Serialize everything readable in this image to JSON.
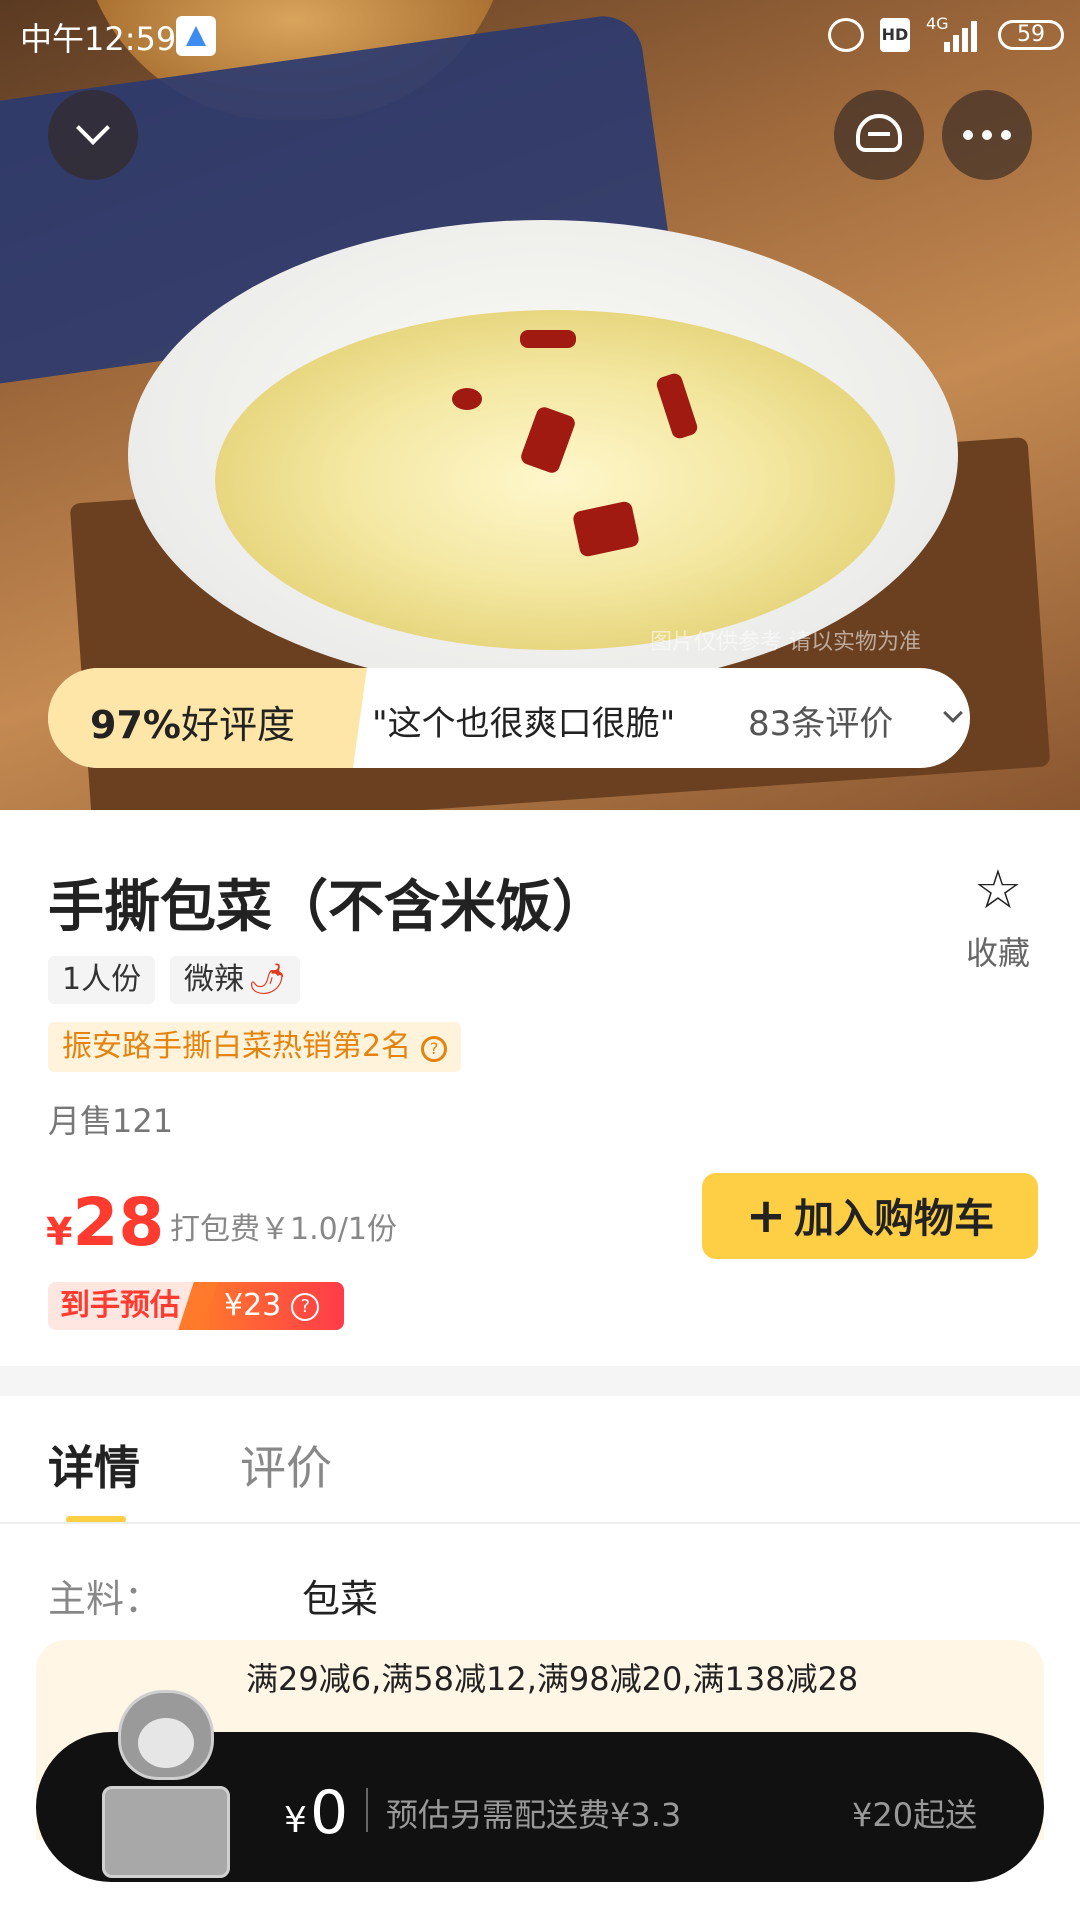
{
  "status_bar": {
    "time": "中午12:59",
    "network": "4G",
    "hd_label": "HD",
    "battery": "59"
  },
  "rating": {
    "percent": "97%",
    "label": "好评度",
    "quote": "\"这个也很爽口很脆\"",
    "count": "83条评价"
  },
  "hero": {
    "watermark": "图片仅供参考 请以实物为准"
  },
  "product": {
    "title": "手撕包菜（不含米饭）",
    "favorite_label": "收藏",
    "tags": [
      "1人份",
      "微辣"
    ],
    "rank_badge": "振安路手撕白菜热销第2名",
    "monthly_sales": "月售121",
    "price_currency": "¥",
    "price_value": "28",
    "packing_fee": "打包费￥1.0/1份",
    "add_to_cart": "加入购物车",
    "estimate_label": "到手预估",
    "estimate_price": "¥23"
  },
  "tabs": [
    {
      "label": "详情",
      "active": true
    },
    {
      "label": "评价",
      "active": false
    }
  ],
  "details": {
    "main_ingredient_label": "主料：",
    "main_ingredient_value": "包菜"
  },
  "promo": {
    "text": "满29减6,满58减12,满98减20,满138减28"
  },
  "bottom_bar": {
    "currency": "¥",
    "amount": "0",
    "delivery_fee": "预估另需配送费¥3.3",
    "min_order": "¥20起送"
  },
  "colors": {
    "accent_yellow": "#fecf45",
    "price_red": "#ff3b30",
    "rank_orange": "#e5830f"
  }
}
